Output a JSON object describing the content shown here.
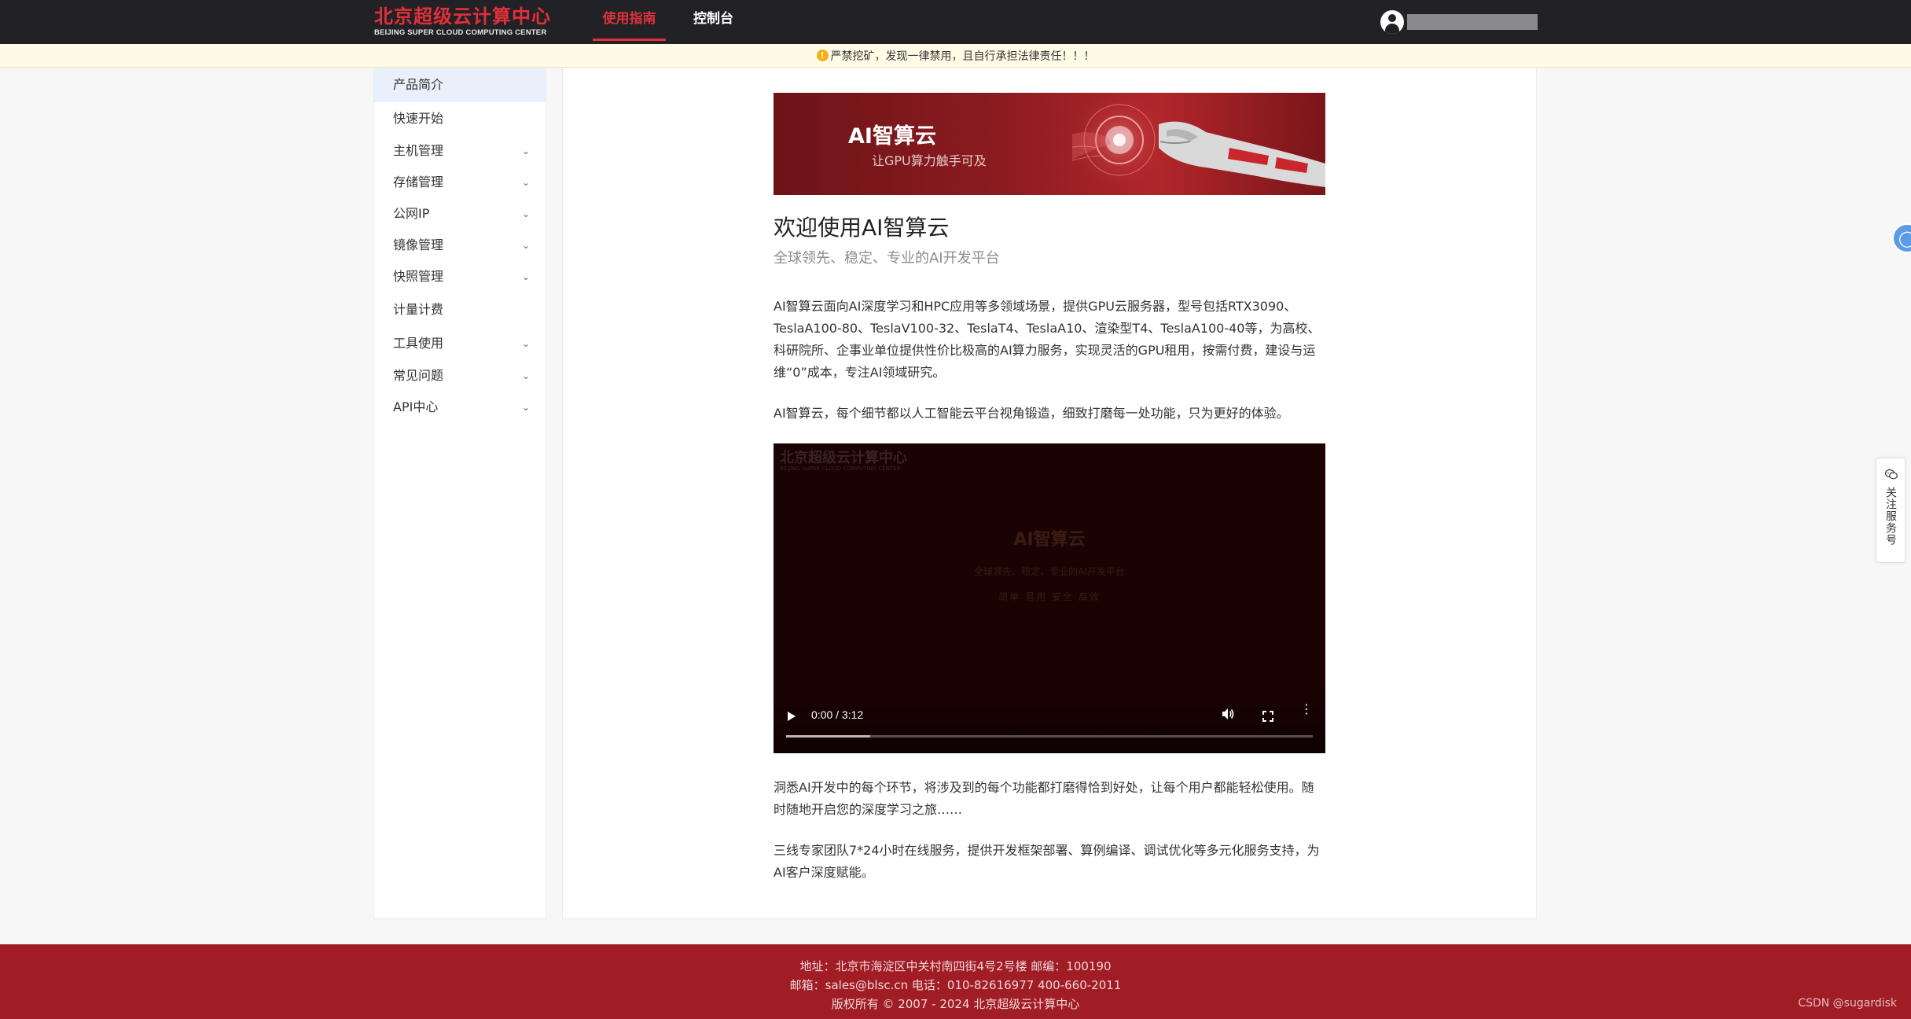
{
  "header": {
    "logo_cn": "北京超级云计算中心",
    "logo_en": "BEIJING SUPER CLOUD COMPUTING CENTER",
    "tabs": [
      {
        "label": "使用指南",
        "active": true
      },
      {
        "label": "控制台",
        "active": false
      }
    ],
    "accent_color": "#e2303a",
    "bg_color": "#222226"
  },
  "notice": {
    "icon": "warning-icon",
    "text": "严禁挖矿，发现一律禁用，且自行承担法律责任！！！"
  },
  "sidebar": {
    "items": [
      {
        "label": "产品简介",
        "expandable": false,
        "active": true
      },
      {
        "label": "快速开始",
        "expandable": false,
        "active": false
      },
      {
        "label": "主机管理",
        "expandable": true,
        "active": false
      },
      {
        "label": "存储管理",
        "expandable": true,
        "active": false
      },
      {
        "label": "公网IP",
        "expandable": true,
        "active": false
      },
      {
        "label": "镜像管理",
        "expandable": true,
        "active": false
      },
      {
        "label": "快照管理",
        "expandable": true,
        "active": false
      },
      {
        "label": "计量计费",
        "expandable": false,
        "active": false
      },
      {
        "label": "工具使用",
        "expandable": true,
        "active": false
      },
      {
        "label": "常见问题",
        "expandable": true,
        "active": false
      },
      {
        "label": "API中心",
        "expandable": true,
        "active": false
      }
    ]
  },
  "main": {
    "banner": {
      "title": "AI智算云",
      "subtitle": "让GPU算力触手可及"
    },
    "title": "欢迎使用AI智算云",
    "subtitle": "全球领先、稳定、专业的AI开发平台",
    "paragraphs": [
      "AI智算云面向AI深度学习和HPC应用等多领域场景，提供GPU云服务器，型号包括RTX3090、TeslaA100-80、TeslaV100-32、TeslaT4、TeslaA10、渲染型T4、TeslaA100-40等，为高校、科研院所、企事业单位提供性价比极高的AI算力服务，实现灵活的GPU租用，按需付费，建设与运维“0”成本，专注AI领域研究。",
      "AI智算云，每个细节都以人工智能云平台视角锻造，细致打磨每一处功能，只为更好的体验。"
    ],
    "video": {
      "watermark_cn": "北京超级云计算中心",
      "watermark_en": "BEIJING SUPER CLOUD COMPUTING CENTER",
      "title": "AI智算云",
      "subtitle": "全球领先、稳定、专业的AI开发平台",
      "tagline": "简单  易用  安全  高效",
      "time": "0:00 / 3:12",
      "buffered_fraction": 0.16
    },
    "paragraphs_after": [
      "洞悉AI开发中的每个环节，将涉及到的每个功能都打磨得恰到好处，让每个用户都能轻松使用。随时随地开启您的深度学习之旅……",
      "三线专家团队7*24小时在线服务，提供开发框架部署、算例编译、调试优化等多元化服务支持，为AI客户深度赋能。"
    ]
  },
  "footer": {
    "address": "地址：北京市海淀区中关村南四街4号2号楼 邮编：100190",
    "contact": "邮箱：sales@blsc.cn 电话：010-82616977 400-660-2011",
    "copyright": "版权所有 © 2007 - 2024 北京超级云计算中心",
    "bg_color": "#a01d26"
  },
  "credit": "CSDN @sugardisk",
  "float": {
    "follow_label": "关注服务号",
    "access_icon": "accessibility-icon",
    "wechat_icon": "wechat-icon"
  }
}
